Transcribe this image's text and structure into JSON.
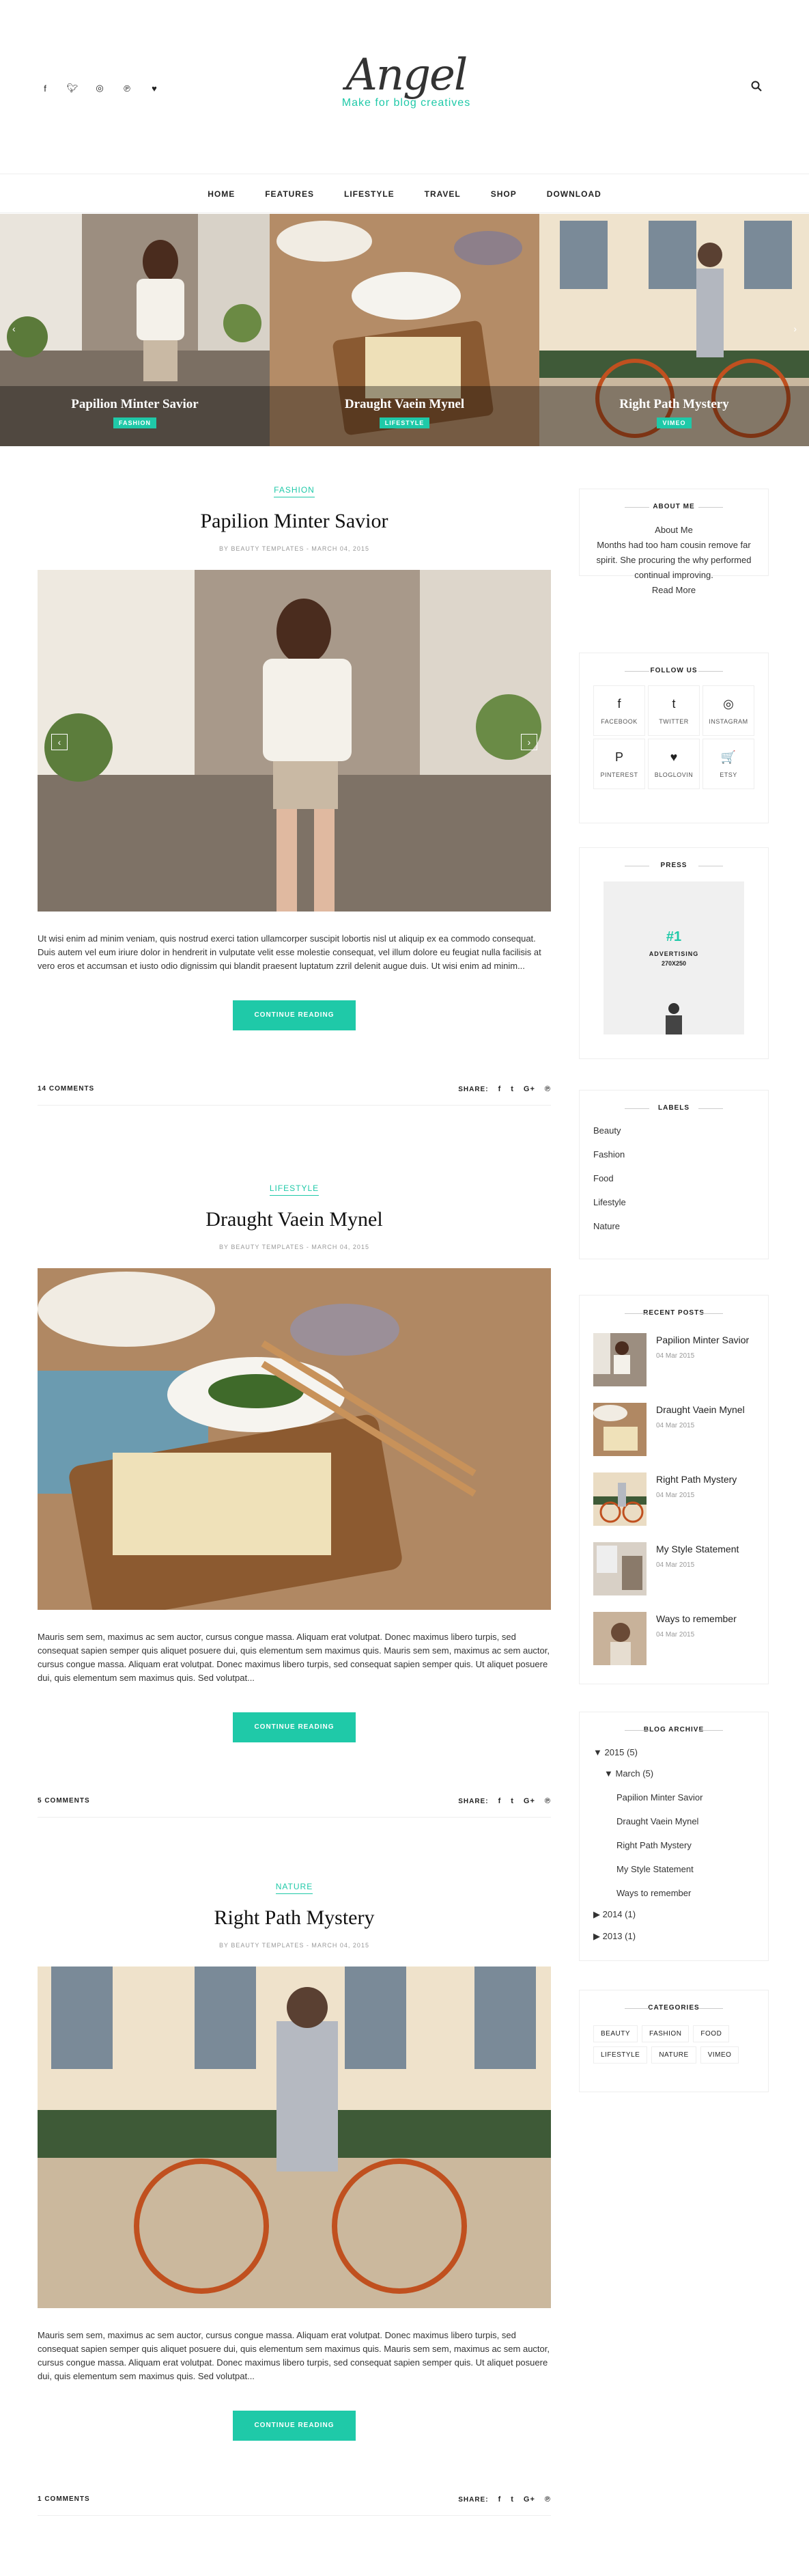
{
  "header": {
    "logo": "Angel",
    "tagline": "Make for blog creatives",
    "social_icons": [
      "facebook-icon",
      "twitter-icon",
      "instagram-icon",
      "pinterest-icon",
      "heart-icon"
    ]
  },
  "nav": [
    "HOME",
    "FEATURES",
    "LIFESTYLE",
    "TRAVEL",
    "SHOP",
    "DOWNLOAD"
  ],
  "slider": [
    {
      "title": "Papilion Minter Savior",
      "badge": "FASHION"
    },
    {
      "title": "Draught Vaein Mynel",
      "badge": "LIFESTYLE"
    },
    {
      "title": "Right Path Mystery",
      "badge": "VIMEO"
    }
  ],
  "posts": [
    {
      "category": "FASHION",
      "title": "Papilion Minter Savior",
      "meta": "BY BEAUTY TEMPLATES - MARCH 04, 2015",
      "excerpt": "Ut wisi enim ad minim veniam, quis nostrud exerci tation ullamcorper suscipit lobortis nisl ut aliquip ex ea commodo consequat. Duis autem vel eum iriure dolor in hendrerit in vulputate velit esse molestie consequat, vel illum dolore eu feugiat nulla facilisis at vero eros et accumsan et iusto odio dignissim qui blandit praesent luptatum zzril delenit augue duis. Ut wisi enim ad minim...",
      "button": "CONTINUE READING",
      "comments": "14 COMMENTS",
      "share": "SHARE:"
    },
    {
      "category": "LIFESTYLE",
      "title": "Draught Vaein Mynel",
      "meta": "BY BEAUTY TEMPLATES - MARCH 04, 2015",
      "excerpt": "Mauris sem sem, maximus ac sem auctor, cursus congue massa. Aliquam erat volutpat. Donec maximus libero turpis, sed consequat sapien semper quis aliquet posuere dui, quis elementum sem maximus quis. Mauris sem sem, maximus ac sem auctor, cursus congue massa. Aliquam erat volutpat. Donec maximus libero turpis, sed consequat sapien semper quis. Ut aliquet posuere dui, quis elementum sem maximus quis. Sed volutpat...",
      "button": "CONTINUE READING",
      "comments": "5 COMMENTS",
      "share": "SHARE:"
    },
    {
      "category": "NATURE",
      "title": "Right Path Mystery",
      "meta": "BY BEAUTY TEMPLATES - MARCH 04, 2015",
      "excerpt": "Mauris sem sem, maximus ac sem auctor, cursus congue massa. Aliquam erat volutpat. Donec maximus libero turpis, sed consequat sapien semper quis aliquet posuere dui, quis elementum sem maximus quis. Mauris sem sem, maximus ac sem auctor, cursus congue massa. Aliquam erat volutpat. Donec maximus libero turpis, sed consequat sapien semper quis. Ut aliquet posuere dui, quis elementum sem maximus quis. Sed volutpat...",
      "button": "CONTINUE READING",
      "comments": "1 COMMENTS",
      "share": "SHARE:"
    }
  ],
  "sidebar": {
    "about": {
      "title": "ABOUT ME",
      "heading": "About Me",
      "text": "Months had too ham cousin remove far spirit. She procuring the why performed continual improving.",
      "more": "Read More"
    },
    "follow": {
      "title": "FOLLOW US",
      "items": [
        {
          "icon": "f",
          "label": "FACEBOOK"
        },
        {
          "icon": "t",
          "label": "TWITTER"
        },
        {
          "icon": "◎",
          "label": "INSTAGRAM"
        },
        {
          "icon": "P",
          "label": "PINTEREST"
        },
        {
          "icon": "♥",
          "label": "BLOGLOVIN"
        },
        {
          "icon": "🛒",
          "label": "ETSY"
        }
      ]
    },
    "press": {
      "title": "PRESS",
      "number": "#1",
      "advertising": "ADVERTISING",
      "size": "270X250"
    },
    "labels": {
      "title": "LABELS",
      "items": [
        "Beauty",
        "Fashion",
        "Food",
        "Lifestyle",
        "Nature"
      ]
    },
    "recent": {
      "title": "RECENT POSTS",
      "items": [
        {
          "title": "Papilion Minter Savior",
          "date": "04 Mar 2015"
        },
        {
          "title": "Draught Vaein Mynel",
          "date": "04 Mar 2015"
        },
        {
          "title": "Right Path Mystery",
          "date": "04 Mar 2015"
        },
        {
          "title": "My Style Statement",
          "date": "04 Mar 2015"
        },
        {
          "title": "Ways to remember",
          "date": "04 Mar 2015"
        }
      ]
    },
    "archive": {
      "title": "BLOG ARCHIVE",
      "year2015": "2015 (5)",
      "march": "March (5)",
      "posts": [
        "Papilion Minter Savior",
        "Draught Vaein Mynel",
        "Right Path Mystery",
        "My Style Statement",
        "Ways to remember"
      ],
      "y2014": "2014 (1)",
      "y2013": "2013 (1)"
    },
    "categories": {
      "title": "CATEGORIES",
      "items": [
        "BEAUTY",
        "FASHION",
        "FOOD",
        "LIFESTYLE",
        "NATURE",
        "VIMEO"
      ]
    }
  }
}
